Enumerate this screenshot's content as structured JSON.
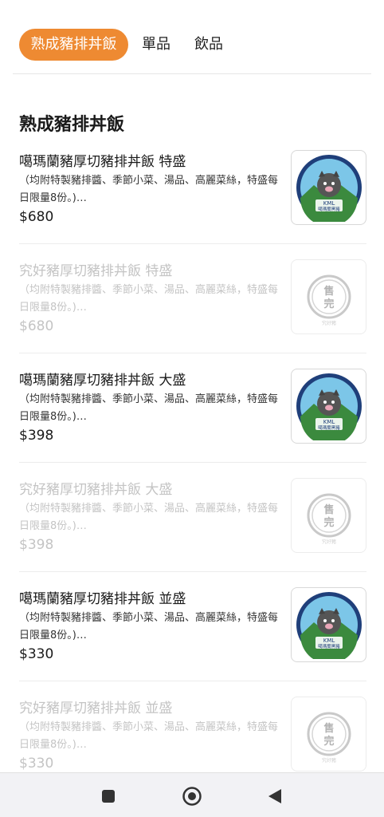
{
  "tabs": [
    {
      "label": "熟成豬排丼飯"
    },
    {
      "label": "單品"
    },
    {
      "label": "飲品"
    }
  ],
  "section": {
    "title": "熟成豬排丼飯"
  },
  "items": [
    {
      "name": "噶瑪蘭豬厚切豬排丼飯 特盛",
      "desc": "（均附特製豬排醬、季節小菜、湯品、高麗菜絲，特盛每日限量8份。)…",
      "price": "$680",
      "status": "available",
      "badge_text": "KML",
      "badge_caption": "噶瑪蘭黑豬"
    },
    {
      "name": "究好豬厚切豬排丼飯 特盛",
      "desc": "（均附特製豬排醬、季節小菜、湯品、高麗菜絲，特盛每日限量8份。)…",
      "price": "$680",
      "status": "soldout",
      "sold_label_1": "售",
      "sold_label_2": "完",
      "sold_caption": "究好豬"
    },
    {
      "name": "噶瑪蘭豬厚切豬排丼飯 大盛",
      "desc": "（均附特製豬排醬、季節小菜、湯品、高麗菜絲，特盛每日限量8份。)…",
      "price": "$398",
      "status": "available",
      "badge_text": "KML",
      "badge_caption": "噶瑪蘭黑豬"
    },
    {
      "name": "究好豬厚切豬排丼飯 大盛",
      "desc": "（均附特製豬排醬、季節小菜、湯品、高麗菜絲，特盛每日限量8份。)…",
      "price": "$398",
      "status": "soldout",
      "sold_label_1": "售",
      "sold_label_2": "完",
      "sold_caption": "究好豬"
    },
    {
      "name": "噶瑪蘭豬厚切豬排丼飯 並盛",
      "desc": "（均附特製豬排醬、季節小菜、湯品、高麗菜絲，特盛每日限量8份。)…",
      "price": "$330",
      "status": "available",
      "badge_text": "KML",
      "badge_caption": "噶瑪蘭黑豬"
    },
    {
      "name": "究好豬厚切豬排丼飯 並盛",
      "desc": "（均附特製豬排醬、季節小菜、湯品、高麗菜絲，特盛每日限量8份。)…",
      "price": "$330",
      "status": "soldout",
      "sold_label_1": "售",
      "sold_label_2": "完",
      "sold_caption": "究好豬"
    }
  ],
  "colors": {
    "accent": "#ee8a32",
    "text": "#1a1a1a",
    "disabled": "#c4c4c4"
  },
  "navbar": {
    "icons": [
      "recents-square-icon",
      "home-circle-icon",
      "back-triangle-icon"
    ]
  }
}
